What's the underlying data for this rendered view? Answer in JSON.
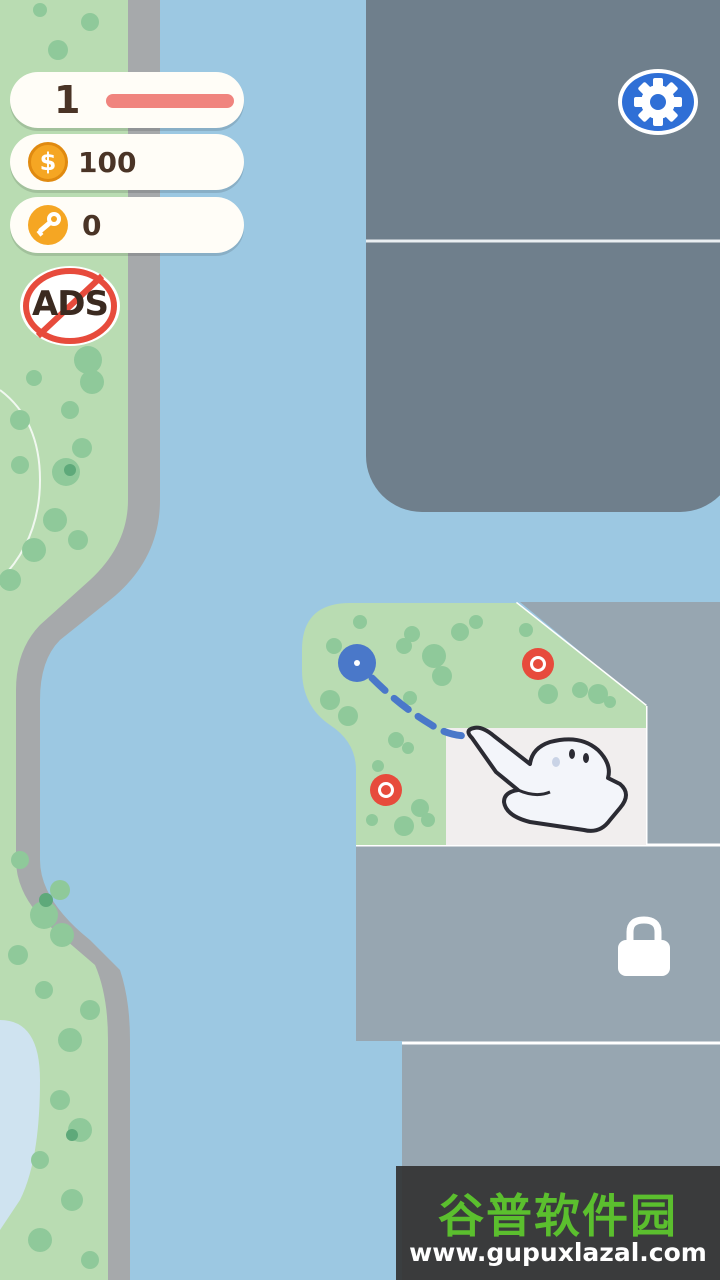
{
  "hud": {
    "level": "1",
    "coins": "100",
    "keys": "0",
    "coin_icon_symbol": "$",
    "no_ads_label": "ADS"
  },
  "icons": {
    "settings": "gear-icon",
    "no_ads": "no-ads-icon",
    "coin": "coin-icon",
    "key": "key-icon",
    "lock": "lock-icon",
    "hand": "pointing-hand-icon"
  },
  "colors": {
    "water": "#9cc8e2",
    "grass": "#b9dcb2",
    "locked_area": "#6f7f8c",
    "level_progress": "#f0847e",
    "start_node": "#4a78c9",
    "target_node": "#e74b3c",
    "settings_button": "#2f6fd6"
  },
  "watermark": {
    "site_name": "谷普软件园",
    "url": "www.gupuxlazal.com"
  }
}
